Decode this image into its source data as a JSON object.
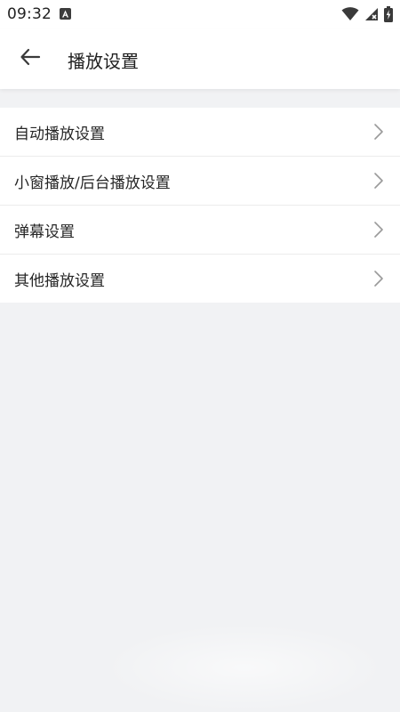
{
  "status_bar": {
    "time": "09:32",
    "icons": [
      "notification-a-icon",
      "wifi-icon",
      "cellular-signal-icon",
      "battery-charging-icon"
    ]
  },
  "app_bar": {
    "back_icon": "arrow-left-icon",
    "title": "播放设置"
  },
  "settings_list": {
    "items": [
      {
        "label": "自动播放设置",
        "icon": "chevron-right-icon"
      },
      {
        "label": "小窗播放/后台播放设置",
        "icon": "chevron-right-icon"
      },
      {
        "label": "弹幕设置",
        "icon": "chevron-right-icon"
      },
      {
        "label": "其他播放设置",
        "icon": "chevron-right-icon"
      }
    ]
  },
  "colors": {
    "background": "#f1f2f4",
    "surface": "#ffffff",
    "text_primary": "#1f1f1f",
    "chevron": "#9a9a9a",
    "divider": "#ececec"
  }
}
